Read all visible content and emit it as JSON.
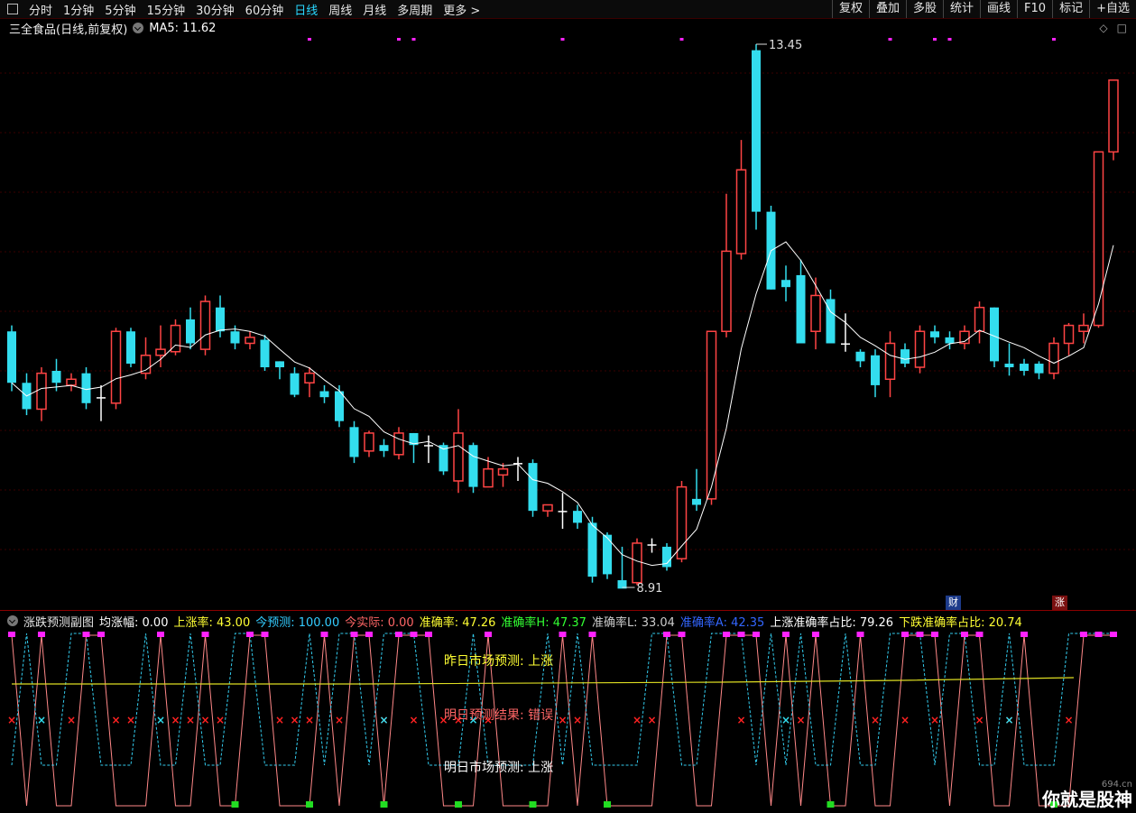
{
  "toolbar": {
    "tabs": [
      "分时",
      "1分钟",
      "5分钟",
      "15分钟",
      "30分钟",
      "60分钟",
      "日线",
      "周线",
      "月线",
      "多周期",
      "更多 >"
    ],
    "active": "日线",
    "right": [
      "复权",
      "叠加",
      "多股",
      "统计",
      "画线",
      "F10",
      "标记",
      "+自选"
    ]
  },
  "main": {
    "title": "三全食品(日线,前复权)",
    "ma_label": "MA5: 11.62",
    "high_label": "13.45",
    "low_label": "8.91",
    "badges": [
      "财",
      "涨"
    ]
  },
  "sub": {
    "name": "涨跌预测副图",
    "items": [
      {
        "text": "均涨幅: 0.00",
        "color": "#ffffff"
      },
      {
        "text": "上涨率: 43.00",
        "color": "#ffff33"
      },
      {
        "text": "今预测: 100.00",
        "color": "#33ccff"
      },
      {
        "text": "今实际: 0.00",
        "color": "#ff6666"
      },
      {
        "text": "准确率: 47.26",
        "color": "#ffff33"
      },
      {
        "text": "准确率H: 47.37",
        "color": "#33ff33"
      },
      {
        "text": "准确率L: 33.04",
        "color": "#cccccc"
      },
      {
        "text": "准确率A: 42.35",
        "color": "#3366ff"
      },
      {
        "text": "上涨准确率占比: 79.26",
        "color": "#ffffff"
      },
      {
        "text": "下跌准确率占比: 20.74",
        "color": "#ffff33"
      }
    ],
    "yesterday": "昨日市场预测: 上涨",
    "result": "明日预测结果: 错误",
    "tomorrow": "明日市场预测: 上涨"
  },
  "colors": {
    "up": "#ff4444",
    "down": "#33ddee",
    "ma": "#ffffff",
    "magenta": "#ff22ff"
  },
  "watermark": "你就是股神",
  "watermark_small": "694.cn",
  "chart_data": {
    "type": "candlestick",
    "ma_name": "MA5",
    "ohlc": [
      [
        11.05,
        10.62,
        10.55,
        11.1
      ],
      [
        10.62,
        10.4,
        10.35,
        10.7
      ],
      [
        10.4,
        10.7,
        10.3,
        10.75
      ],
      [
        10.72,
        10.62,
        10.55,
        10.82
      ],
      [
        10.6,
        10.65,
        10.55,
        10.7
      ],
      [
        10.7,
        10.45,
        10.4,
        10.75
      ],
      [
        10.5,
        10.5,
        10.3,
        10.6
      ],
      [
        10.45,
        11.05,
        10.4,
        11.08
      ],
      [
        11.05,
        10.78,
        10.75,
        11.08
      ],
      [
        10.7,
        10.85,
        10.65,
        11.0
      ],
      [
        10.85,
        10.9,
        10.75,
        11.1
      ],
      [
        10.88,
        11.1,
        10.85,
        11.15
      ],
      [
        11.15,
        10.95,
        10.9,
        11.25
      ],
      [
        10.9,
        11.3,
        10.85,
        11.35
      ],
      [
        11.25,
        11.05,
        11.0,
        11.35
      ],
      [
        11.05,
        10.95,
        10.9,
        11.1
      ],
      [
        10.95,
        11.0,
        10.9,
        11.05
      ],
      [
        10.98,
        10.75,
        10.72,
        11.02
      ],
      [
        10.8,
        10.75,
        10.65,
        10.8
      ],
      [
        10.7,
        10.52,
        10.5,
        10.75
      ],
      [
        10.62,
        10.7,
        10.5,
        10.75
      ],
      [
        10.55,
        10.5,
        10.45,
        10.6
      ],
      [
        10.55,
        10.3,
        10.25,
        10.6
      ],
      [
        10.25,
        10.0,
        9.95,
        10.3
      ],
      [
        10.05,
        10.2,
        10.0,
        10.22
      ],
      [
        10.1,
        10.05,
        10.0,
        10.15
      ],
      [
        10.02,
        10.2,
        9.98,
        10.25
      ],
      [
        10.2,
        10.1,
        9.95,
        10.2
      ],
      [
        10.1,
        10.1,
        9.95,
        10.18
      ],
      [
        10.1,
        9.88,
        9.85,
        10.12
      ],
      [
        9.8,
        10.2,
        9.7,
        10.4
      ],
      [
        10.1,
        9.75,
        9.7,
        10.12
      ],
      [
        9.75,
        9.9,
        9.75,
        10.0
      ],
      [
        9.85,
        9.9,
        9.75,
        9.95
      ],
      [
        9.95,
        9.95,
        9.8,
        10.0
      ],
      [
        9.95,
        9.55,
        9.5,
        9.98
      ],
      [
        9.55,
        9.6,
        9.5,
        9.6
      ],
      [
        9.55,
        9.55,
        9.4,
        9.7
      ],
      [
        9.55,
        9.45,
        9.4,
        9.6
      ],
      [
        9.45,
        9.0,
        8.95,
        9.5
      ],
      [
        9.35,
        9.02,
        8.98,
        9.37
      ],
      [
        8.97,
        8.9,
        8.91,
        9.25
      ],
      [
        8.95,
        9.28,
        8.93,
        9.32
      ],
      [
        9.27,
        9.27,
        9.2,
        9.32
      ],
      [
        9.25,
        9.08,
        9.05,
        9.28
      ],
      [
        9.15,
        9.75,
        9.12,
        9.8
      ],
      [
        9.65,
        9.6,
        9.55,
        9.9
      ],
      [
        9.65,
        11.05,
        9.6,
        11.05
      ],
      [
        11.05,
        11.72,
        11.0,
        12.2
      ],
      [
        11.7,
        12.4,
        11.65,
        12.65
      ],
      [
        13.4,
        12.05,
        11.9,
        13.45
      ],
      [
        12.05,
        11.4,
        11.4,
        12.1
      ],
      [
        11.48,
        11.42,
        11.3,
        11.6
      ],
      [
        11.52,
        10.95,
        10.95,
        11.65
      ],
      [
        11.05,
        11.35,
        10.9,
        11.5
      ],
      [
        11.32,
        10.95,
        10.95,
        11.4
      ],
      [
        10.95,
        10.95,
        10.88,
        11.2
      ],
      [
        10.88,
        10.8,
        10.75,
        10.9
      ],
      [
        10.85,
        10.6,
        10.5,
        10.9
      ],
      [
        10.65,
        10.95,
        10.5,
        11.05
      ],
      [
        10.9,
        10.78,
        10.75,
        10.95
      ],
      [
        10.75,
        11.05,
        10.7,
        11.1
      ],
      [
        11.05,
        11.0,
        10.95,
        11.1
      ],
      [
        11.0,
        10.95,
        10.9,
        11.05
      ],
      [
        10.95,
        11.05,
        10.9,
        11.1
      ],
      [
        11.05,
        11.25,
        10.95,
        11.3
      ],
      [
        11.25,
        10.8,
        10.75,
        11.25
      ],
      [
        10.78,
        10.75,
        10.68,
        10.95
      ],
      [
        10.78,
        10.72,
        10.68,
        10.82
      ],
      [
        10.78,
        10.7,
        10.65,
        10.8
      ],
      [
        10.7,
        10.95,
        10.65,
        11.0
      ],
      [
        10.95,
        11.1,
        10.85,
        11.12
      ],
      [
        11.05,
        11.1,
        10.95,
        11.2
      ],
      [
        11.1,
        12.55,
        11.08,
        12.55
      ],
      [
        12.55,
        13.15,
        12.48,
        13.15
      ]
    ]
  }
}
